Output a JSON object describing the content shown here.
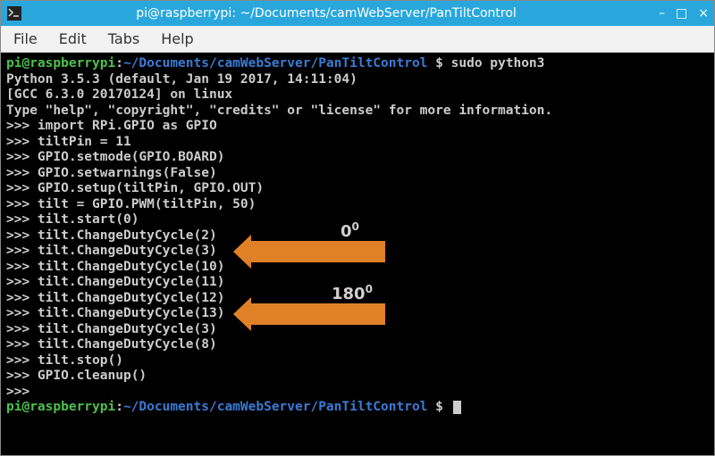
{
  "titlebar": {
    "title": "pi@raspberrypi: ~/Documents/camWebServer/PanTiltControl",
    "icon": "terminal-icon"
  },
  "menubar": {
    "items": [
      "File",
      "Edit",
      "Tabs",
      "Help"
    ]
  },
  "prompt": {
    "user_host": "pi@raspberrypi",
    "path": "~/Documents/camWebServer/PanTiltControl",
    "sep": ":",
    "sigil": "$"
  },
  "session": {
    "command": "sudo python3",
    "header_lines": [
      "Python 3.5.3 (default, Jan 19 2017, 14:11:04)",
      "[GCC 6.3.0 20170124] on linux",
      "Type \"help\", \"copyright\", \"credits\" or \"license\" for more information."
    ],
    "repl_prompt": ">>>",
    "repl_lines": [
      "import RPi.GPIO as GPIO",
      "tiltPin = 11",
      "GPIO.setmode(GPIO.BOARD)",
      "GPIO.setwarnings(False)",
      "GPIO.setup(tiltPin, GPIO.OUT)",
      "tilt = GPIO.PWM(tiltPin, 50)",
      "tilt.start(0)",
      "tilt.ChangeDutyCycle(2)",
      "tilt.ChangeDutyCycle(3)",
      "tilt.ChangeDutyCycle(10)",
      "tilt.ChangeDutyCycle(11)",
      "tilt.ChangeDutyCycle(12)",
      "tilt.ChangeDutyCycle(13)",
      "tilt.ChangeDutyCycle(3)",
      "tilt.ChangeDutyCycle(8)",
      "tilt.stop()",
      "GPIO.cleanup()",
      ""
    ]
  },
  "annotations": {
    "arrow1_label_base": "0",
    "arrow1_label_sup": "0",
    "arrow2_label_base": "180",
    "arrow2_label_sup": "0"
  }
}
